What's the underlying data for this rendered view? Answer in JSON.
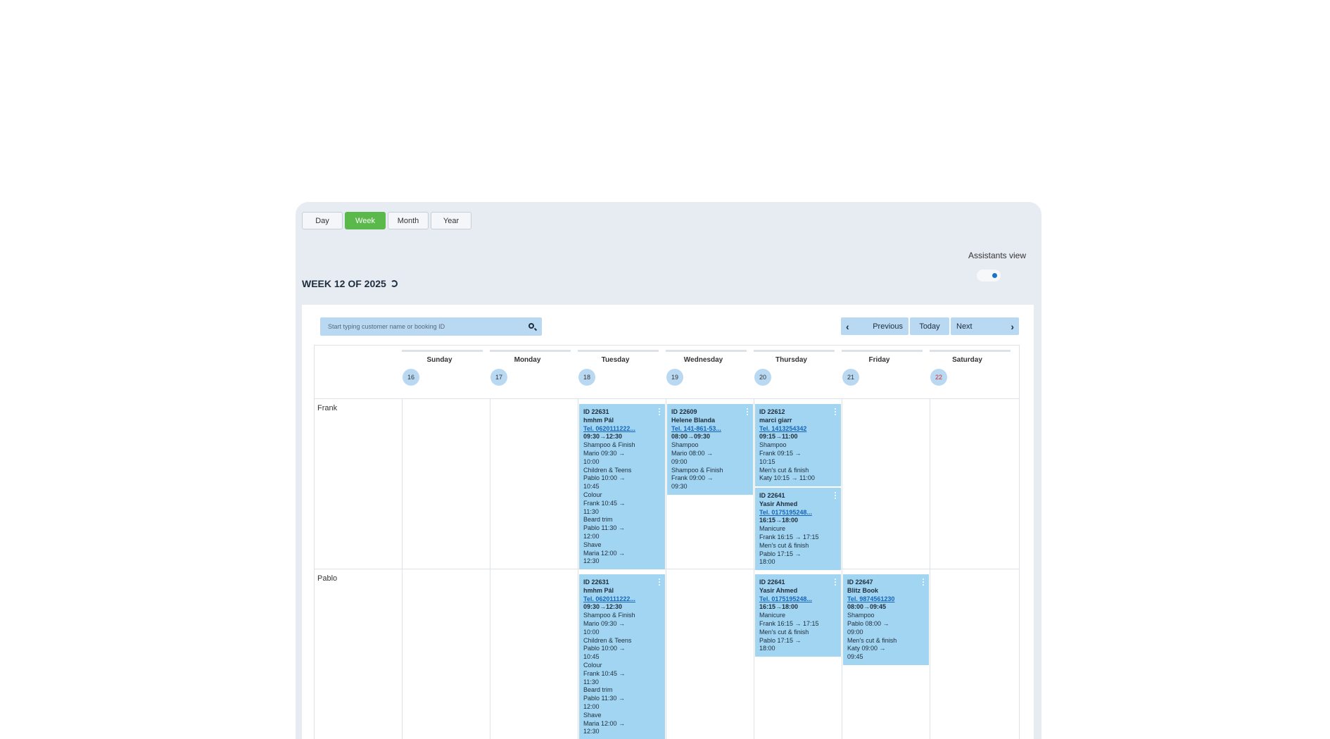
{
  "view_buttons": [
    "Day",
    "Week",
    "Month",
    "Year"
  ],
  "active_view": "Week",
  "assistants_view_label": "Assistants view",
  "week_title": "WEEK 12 OF 2025",
  "search": {
    "placeholder": "Start typing customer name or booking ID"
  },
  "nav": {
    "previous": "Previous",
    "today": "Today",
    "next": "Next"
  },
  "days": [
    {
      "name": "Sunday",
      "number": "16"
    },
    {
      "name": "Monday",
      "number": "17"
    },
    {
      "name": "Tuesday",
      "number": "18"
    },
    {
      "name": "Wednesday",
      "number": "19"
    },
    {
      "name": "Thursday",
      "number": "20"
    },
    {
      "name": "Friday",
      "number": "21"
    },
    {
      "name": "Saturday",
      "number": "22"
    }
  ],
  "today_index": 6,
  "assistants": [
    "Frank",
    "Pablo"
  ],
  "appointments": [
    {
      "row": 0,
      "day": 2,
      "slot": 0,
      "id": "ID 22631",
      "name": "hmhm Pál",
      "tel": "Tel. 0620111222...",
      "time": "09:30→12:30",
      "lines": [
        "Shampoo & Finish",
        "Mario 09:30 →",
        "10:00",
        "Children & Teens",
        "Pablo 10:00 →",
        "10:45",
        "Colour",
        "Frank 10:45 →",
        "11:30",
        "Beard trim",
        "Pablo 11:30 →",
        "12:00",
        "Shave",
        "Maria 12:00 →",
        "12:30"
      ]
    },
    {
      "row": 0,
      "day": 3,
      "slot": 0,
      "id": "ID 22609",
      "name": "Helene Blanda",
      "tel": "Tel. 141-861-53...",
      "time": "08:00→09:30",
      "lines": [
        "Shampoo",
        "Mario 08:00 →",
        "09:00",
        "Shampoo & Finish",
        "Frank 09:00 →",
        "09:30"
      ]
    },
    {
      "row": 0,
      "day": 4,
      "slot": 0,
      "id": "ID 22612",
      "name": "marci giarr",
      "tel": "Tel. 1413254342",
      "time": "09:15→11:00",
      "lines": [
        "Shampoo",
        "Frank 09:15 →",
        "10:15",
        "Men's cut & finish",
        "Katy 10:15 → 11:00"
      ]
    },
    {
      "row": 0,
      "day": 4,
      "slot": 1,
      "id": "ID 22641",
      "name": "Yasir Ahmed",
      "tel": "Tel. 0175195248...",
      "time": "16:15→18:00",
      "lines": [
        "Manicure",
        "Frank 16:15 → 17:15",
        "Men's cut & finish",
        "Pablo 17:15 →",
        "18:00"
      ]
    },
    {
      "row": 1,
      "day": 2,
      "slot": 0,
      "id": "ID 22631",
      "name": "hmhm Pál",
      "tel": "Tel. 0620111222...",
      "time": "09:30→12:30",
      "lines": [
        "Shampoo & Finish",
        "Mario 09:30 →",
        "10:00",
        "Children & Teens",
        "Pablo 10:00 →",
        "10:45",
        "Colour",
        "Frank 10:45 →",
        "11:30",
        "Beard trim",
        "Pablo 11:30 →",
        "12:00",
        "Shave",
        "Maria 12:00 →",
        "12:30"
      ]
    },
    {
      "row": 1,
      "day": 4,
      "slot": 0,
      "id": "ID 22641",
      "name": "Yasir Ahmed",
      "tel": "Tel. 0175195248...",
      "time": "16:15→18:00",
      "lines": [
        "Manicure",
        "Frank 16:15 → 17:15",
        "Men's cut & finish",
        "Pablo 17:15 →",
        "18:00"
      ]
    },
    {
      "row": 1,
      "day": 5,
      "slot": 0,
      "id": "ID 22647",
      "name": "Blitz Book",
      "tel": "Tel. 9874561230",
      "time": "08:00→09:45",
      "lines": [
        "Shampoo",
        "Pablo 08:00 →",
        "09:00",
        "Men's cut & finish",
        "Katy 09:00 →",
        "09:45"
      ]
    }
  ],
  "colors": {
    "active_green": "#5ab94a",
    "appointment_blue": "#a1d5f1",
    "today_red": "#d32f2f"
  }
}
